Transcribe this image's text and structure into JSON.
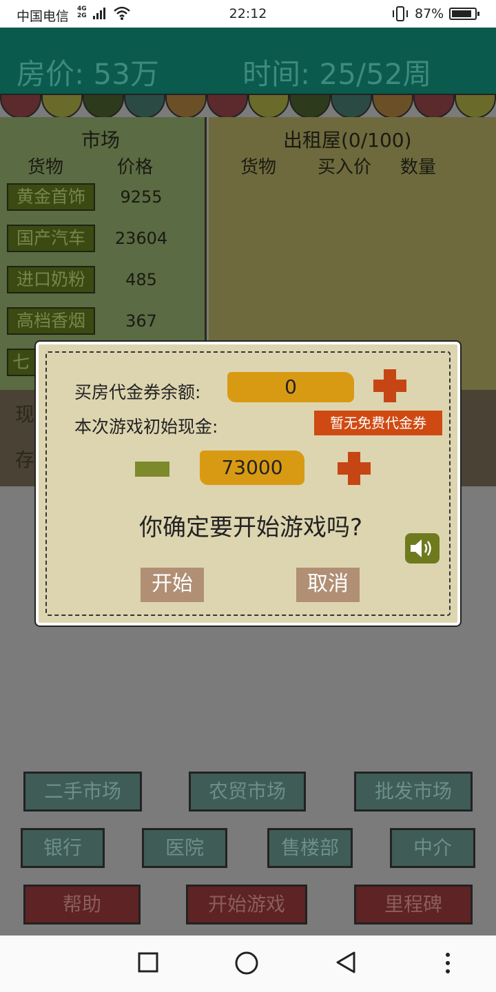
{
  "status_bar": {
    "carrier": "中国电信",
    "network_top": "4G",
    "network_bottom": "2G",
    "time": "22:12",
    "battery_percent": "87%",
    "battery_level": 0.87
  },
  "header": {
    "house_price": "房价: 53万",
    "time_week": "时间: 25/52周"
  },
  "market": {
    "title": "市场",
    "col_goods": "货物",
    "col_price": "价格",
    "items": [
      {
        "name": "黄金首饰",
        "price": "9255"
      },
      {
        "name": "国产汽车",
        "price": "23604"
      },
      {
        "name": "进口奶粉",
        "price": "485"
      },
      {
        "name": "高档香烟",
        "price": "367"
      },
      {
        "name": "七",
        "price": ""
      }
    ]
  },
  "rental": {
    "title": "出租屋(0/100)",
    "col_goods": "货物",
    "col_buy_price": "买入价",
    "col_qty": "数量"
  },
  "cash_strip": {
    "line1": "现",
    "line2": "存"
  },
  "dialog": {
    "voucher_label": "买房代金券余额:",
    "voucher_value": "0",
    "initial_cash_label": "本次游戏初始现金:",
    "no_voucher_tag": "暂无免费代金券",
    "cash_value": "73000",
    "question": "你确定要开始游戏吗?",
    "start_label": "开始",
    "cancel_label": "取消"
  },
  "bottom_buttons": {
    "row1": [
      "二手市场",
      "农贸市场",
      "批发市场"
    ],
    "row2": [
      "银行",
      "医院",
      "售楼部",
      "中介"
    ],
    "row3": [
      "帮助",
      "开始游戏",
      "里程碑"
    ]
  },
  "colors": {
    "dialog_bg": "#ddd5b0",
    "accent_orange": "#d99a13",
    "plus_red": "#c64514",
    "minus_green": "#7c8a2c",
    "teal_header": "#0a5a4e"
  },
  "icons": {
    "sound": "speaker-icon",
    "nav_recent": "square-icon",
    "nav_home": "circle-icon",
    "nav_back": "triangle-back-icon",
    "nav_more": "dots-icon"
  }
}
